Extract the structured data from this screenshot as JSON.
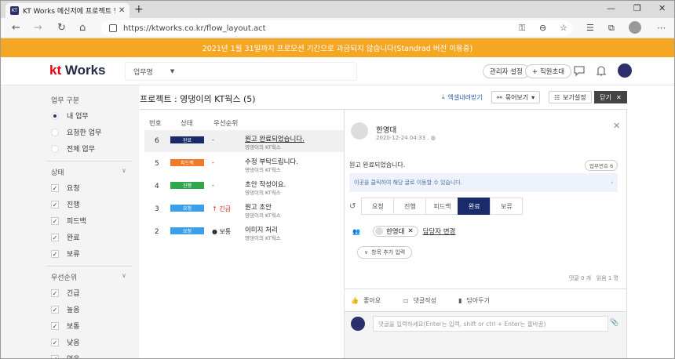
{
  "browser": {
    "tab_title": "KT Works 메신저에 프로젝트 협...",
    "url": "https://ktworks.co.kr/flow_layout.act"
  },
  "banner": {
    "text": "2021년 1월 31일까지 프로모션 기간으로 과금되지 않습니다(Standrad 버전 이용중)"
  },
  "header": {
    "logo_kt": "kt",
    "logo_works": "Works",
    "workspace": "업무명",
    "admin_label": "관리자 설정",
    "invite_label": "+ 직원초대"
  },
  "sidebar": {
    "work_title": "업무 구분",
    "work_items": [
      {
        "label": "내 업무",
        "selected": true
      },
      {
        "label": "요청한 업무",
        "selected": false
      },
      {
        "label": "전체 업무",
        "selected": false
      }
    ],
    "status_title": "상태",
    "status_items": [
      "요청",
      "진행",
      "피드백",
      "완료",
      "보류"
    ],
    "priority_title": "우선순위",
    "priority_items": [
      "긴급",
      "높음",
      "보통",
      "낮음",
      "없음"
    ]
  },
  "main": {
    "title": "프로젝트 : 영댕이의 KT웍스 (5)",
    "excel_label": "엑셀내려받기",
    "group_label": "묶어보기",
    "view_label": "보기설정",
    "close_label": "닫기",
    "columns": {
      "no": "번호",
      "status": "상태",
      "priority": "우선순위"
    },
    "rows": [
      {
        "no": "6",
        "status": "완료",
        "status_color": "#1a2b6b",
        "priority": "-",
        "title": "원고 완료되었습니다.",
        "project": "영댕이의 KT웍스",
        "selected": true
      },
      {
        "no": "5",
        "status": "피드백",
        "status_color": "#f07a2a",
        "priority": "-",
        "title": "수정 부탁드립니다.",
        "project": "영댕이의 KT웍스",
        "selected": false
      },
      {
        "no": "4",
        "status": "진행",
        "status_color": "#2ea84a",
        "priority": "-",
        "title": "초안 작성이요.",
        "project": "영댕이의 KT웍스",
        "selected": false
      },
      {
        "no": "3",
        "status": "요청",
        "status_color": "#3aa0e8",
        "priority": "↑ 긴급",
        "priority_color": "#e02020",
        "title": "원고 초안",
        "project": "영댕이의 KT웍스",
        "selected": false
      },
      {
        "no": "2",
        "status": "요청",
        "status_color": "#3aa0e8",
        "priority": "● 보통",
        "priority_color": "#333333",
        "title": "이미지 처리",
        "project": "영댕이의 KT웍스",
        "selected": false
      }
    ]
  },
  "detail": {
    "user_name": "한영대",
    "date": "2020-12-24 04:33 .",
    "description": "원고 완료되었습니다.",
    "task_number": "업무번호 6",
    "notice": "이곳을 클릭하여 해당 글로 이동할 수 있습니다.",
    "status_tabs": [
      {
        "label": "요청",
        "active": false
      },
      {
        "label": "진행",
        "active": false
      },
      {
        "label": "피드백",
        "active": false
      },
      {
        "label": "완료",
        "active": true
      },
      {
        "label": "보류",
        "active": false
      }
    ],
    "assignee": "한영대",
    "change_assignee": "담당자 변경",
    "add_item": "항목 추가 입력",
    "comment_count": "댓글 0 개",
    "read_count": "읽음 1 명",
    "like_label": "좋아요",
    "comment_label": "댓글작성",
    "save_label": "담아두기",
    "comment_placeholder": "댓글을 입력하세요(Enter는 입력, shift or ctrl + Enter는 줄바꿈)"
  }
}
